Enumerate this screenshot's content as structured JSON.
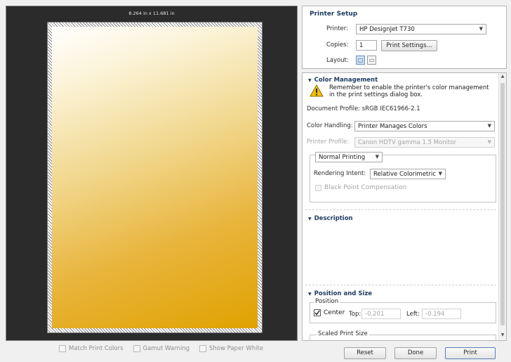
{
  "preview": {
    "dimensions": "8.264 in x 11.681 in",
    "checkboxes": [
      {
        "label": "Match Print Colors"
      },
      {
        "label": "Gamut Warning"
      },
      {
        "label": "Show Paper White"
      }
    ]
  },
  "printer_setup": {
    "title": "Printer Setup",
    "printer_label": "Printer:",
    "printer_value": "HP DesignJet T730",
    "copies_label": "Copies:",
    "copies_value": "1",
    "print_settings_button": "Print Settings...",
    "layout_label": "Layout:"
  },
  "color_management": {
    "title": "Color Management",
    "warning_text": "Remember to enable the printer's color management in the print settings dialog box.",
    "document_profile": "Document Profile: sRGB IEC61966-2.1",
    "color_handling_label": "Color Handling:",
    "color_handling_value": "Printer Manages Colors",
    "printer_profile_label": "Printer Profile:",
    "printer_profile_value": "Canon HDTV gamma 1.5 Monitor",
    "print_mode_value": "Normal Printing",
    "rendering_intent_label": "Rendering Intent:",
    "rendering_intent_value": "Relative Colorimetric",
    "black_point_label": "Black Point Compensation"
  },
  "description": {
    "title": "Description"
  },
  "position_size": {
    "title": "Position and Size",
    "position_group": "Position",
    "center_label": "Center",
    "top_label": "Top:",
    "top_value": "-0.201",
    "left_label": "Left:",
    "left_value": "-0.194",
    "scaled_group": "Scaled Print Size"
  },
  "buttons": {
    "reset": "Reset",
    "done": "Done",
    "print": "Print"
  },
  "colors": {
    "accent": "#1f3c63",
    "preview_bg": "#2b2b2b",
    "warning": "#f2c200"
  }
}
